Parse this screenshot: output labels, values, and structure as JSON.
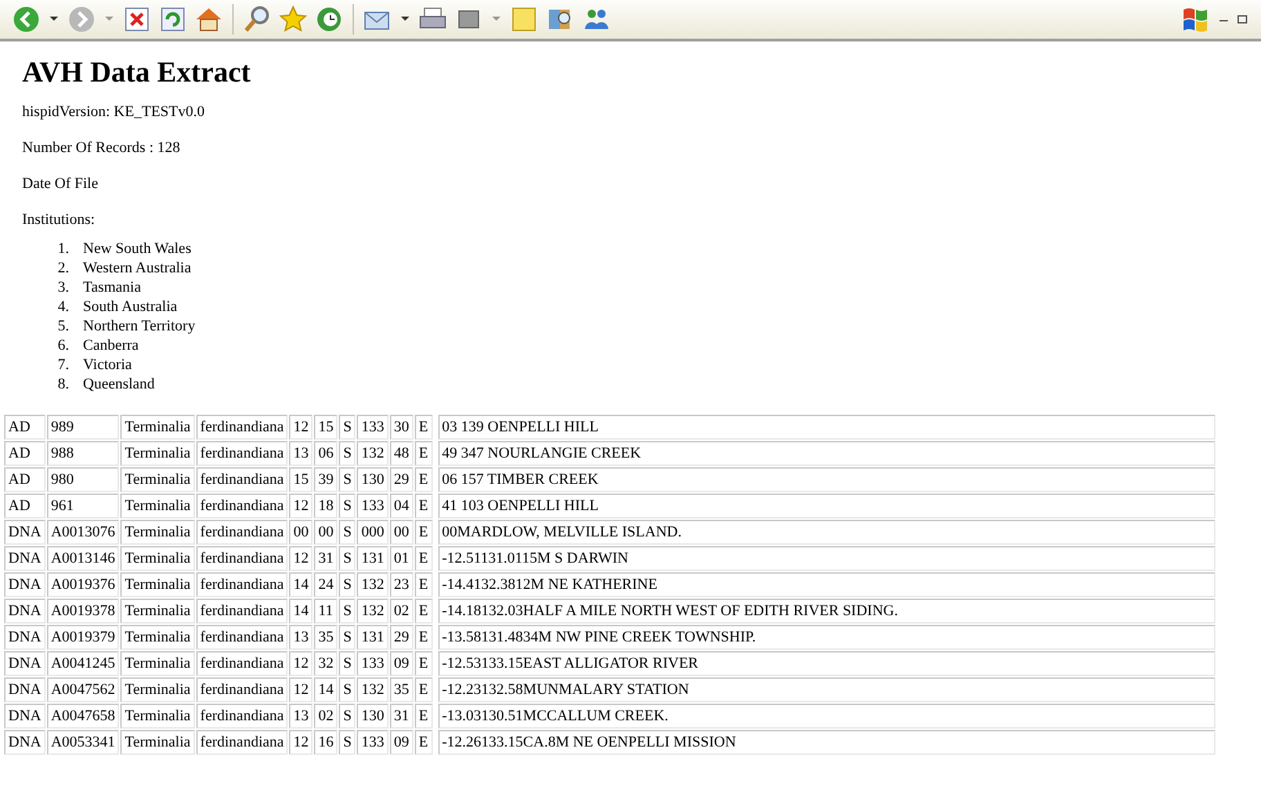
{
  "title": "AVH Data Extract",
  "fields": [
    "hispidVersion: KE_TESTv0.0",
    "Number Of Records : 128",
    "Date Of File",
    "Institutions:"
  ],
  "institutions": [
    {
      "number": "1.",
      "name": "New South Wales"
    },
    {
      "number": "2.",
      "name": "Western Australia"
    },
    {
      "number": "3.",
      "name": "Tasmania"
    },
    {
      "number": "4.",
      "name": "South Australia"
    },
    {
      "number": "5.",
      "name": "Northern Territory"
    },
    {
      "number": "6.",
      "name": "Canberra"
    },
    {
      "number": "7.",
      "name": "Victoria"
    },
    {
      "number": "8.",
      "name": "Queensland"
    }
  ],
  "records": [
    [
      "AD",
      "989",
      "Terminalia",
      "ferdinandiana",
      "12",
      "15",
      "S",
      "133",
      "30",
      "E",
      "03 139 OENPELLI HILL"
    ],
    [
      "AD",
      "988",
      "Terminalia",
      "ferdinandiana",
      "13",
      "06",
      "S",
      "132",
      "48",
      "E",
      "49 347 NOURLANGIE CREEK"
    ],
    [
      "AD",
      "980",
      "Terminalia",
      "ferdinandiana",
      "15",
      "39",
      "S",
      "130",
      "29",
      "E",
      "06 157 TIMBER CREEK"
    ],
    [
      "AD",
      "961",
      "Terminalia",
      "ferdinandiana",
      "12",
      "18",
      "S",
      "133",
      "04",
      "E",
      "41 103 OENPELLI HILL"
    ],
    [
      "DNA",
      "A0013076",
      "Terminalia",
      "ferdinandiana",
      "00",
      "00",
      "S",
      "000",
      "00",
      "E",
      "00MARDLOW, MELVILLE ISLAND."
    ],
    [
      "DNA",
      "A0013146",
      "Terminalia",
      "ferdinandiana",
      "12",
      "31",
      "S",
      "131",
      "01",
      "E",
      "-12.51131.0115M S DARWIN"
    ],
    [
      "DNA",
      "A0019376",
      "Terminalia",
      "ferdinandiana",
      "14",
      "24",
      "S",
      "132",
      "23",
      "E",
      "-14.4132.3812M NE KATHERINE"
    ],
    [
      "DNA",
      "A0019378",
      "Terminalia",
      "ferdinandiana",
      "14",
      "11",
      "S",
      "132",
      "02",
      "E",
      "-14.18132.03HALF A MILE NORTH WEST OF EDITH RIVER SIDING."
    ],
    [
      "DNA",
      "A0019379",
      "Terminalia",
      "ferdinandiana",
      "13",
      "35",
      "S",
      "131",
      "29",
      "E",
      "-13.58131.4834M NW PINE CREEK TOWNSHIP."
    ],
    [
      "DNA",
      "A0041245",
      "Terminalia",
      "ferdinandiana",
      "12",
      "32",
      "S",
      "133",
      "09",
      "E",
      "-12.53133.15EAST ALLIGATOR RIVER"
    ],
    [
      "DNA",
      "A0047562",
      "Terminalia",
      "ferdinandiana",
      "12",
      "14",
      "S",
      "132",
      "35",
      "E",
      "-12.23132.58MUNMALARY STATION"
    ],
    [
      "DNA",
      "A0047658",
      "Terminalia",
      "ferdinandiana",
      "13",
      "02",
      "S",
      "130",
      "31",
      "E",
      "-13.03130.51MCCALLUM CREEK."
    ],
    [
      "DNA",
      "A0053341",
      "Terminalia",
      "ferdinandiana",
      "12",
      "16",
      "S",
      "133",
      "09",
      "E",
      "-12.26133.15CA.8M NE OENPELLI MISSION"
    ]
  ]
}
